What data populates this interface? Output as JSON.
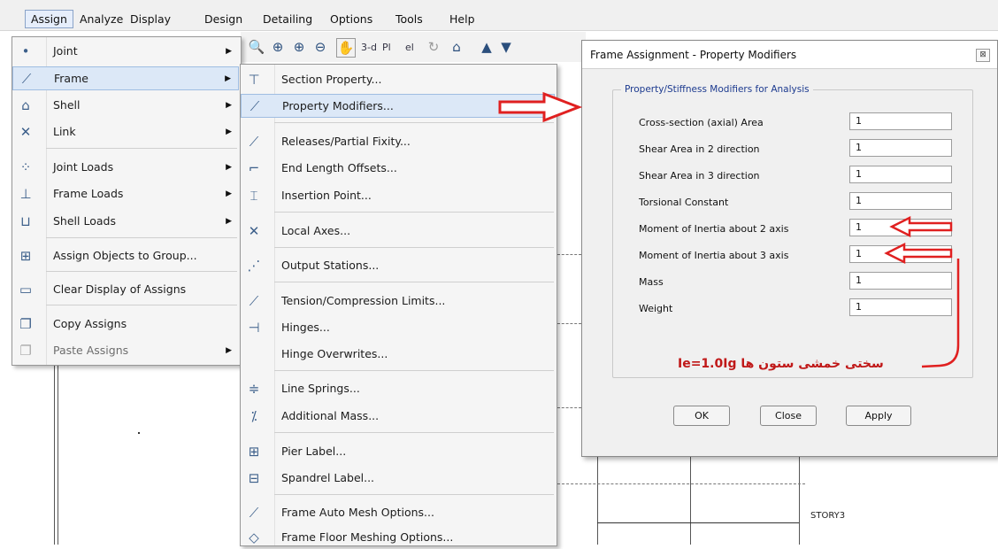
{
  "menubar": [
    "Assign",
    "Analyze",
    "Display",
    "Design",
    "Detailing",
    "Options",
    "Tools",
    "Help"
  ],
  "toolbar": {
    "view_3d": "3-d",
    "view_plan": "Pl",
    "view_elev": "el"
  },
  "assign_menu": {
    "items": [
      {
        "label": "Joint",
        "icon": "joint-icon",
        "submenu": true
      },
      {
        "label": "Frame",
        "icon": "frame-icon",
        "submenu": true,
        "highlighted": true
      },
      {
        "label": "Shell",
        "icon": "shell-icon",
        "submenu": true
      },
      {
        "label": "Link",
        "icon": "link-icon",
        "submenu": true
      },
      {
        "label": "Joint Loads",
        "icon": "joint-loads-icon",
        "submenu": true
      },
      {
        "label": "Frame Loads",
        "icon": "frame-loads-icon",
        "submenu": true
      },
      {
        "label": "Shell Loads",
        "icon": "shell-loads-icon",
        "submenu": true
      },
      {
        "label": "Assign Objects to Group...",
        "icon": "group-icon"
      },
      {
        "label": "Clear Display of Assigns",
        "icon": "clear-display-icon"
      },
      {
        "label": "Copy Assigns",
        "icon": "copy-icon"
      },
      {
        "label": "Paste Assigns",
        "icon": "paste-icon",
        "submenu": true,
        "disabled": true
      }
    ]
  },
  "frame_submenu": {
    "items": [
      {
        "label": "Section Property...",
        "icon": "section-property-icon"
      },
      {
        "label": "Property Modifiers...",
        "icon": "property-modifiers-icon",
        "highlighted": true
      },
      {
        "label": "Releases/Partial Fixity...",
        "icon": "releases-icon"
      },
      {
        "label": "End Length Offsets...",
        "icon": "end-offsets-icon"
      },
      {
        "label": "Insertion Point...",
        "icon": "insertion-point-icon"
      },
      {
        "label": "Local Axes...",
        "icon": "local-axes-icon"
      },
      {
        "label": "Output Stations...",
        "icon": "output-stations-icon"
      },
      {
        "label": "Tension/Compression Limits...",
        "icon": "tension-limits-icon"
      },
      {
        "label": "Hinges...",
        "icon": "hinges-icon"
      },
      {
        "label": "Hinge Overwrites...",
        "icon": ""
      },
      {
        "label": "Line Springs...",
        "icon": "line-springs-icon"
      },
      {
        "label": "Additional Mass...",
        "icon": "additional-mass-icon"
      },
      {
        "label": "Pier Label...",
        "icon": "pier-label-icon"
      },
      {
        "label": "Spandrel Label...",
        "icon": "spandrel-label-icon"
      },
      {
        "label": "Frame Auto Mesh Options...",
        "icon": "auto-mesh-icon"
      },
      {
        "label": "Frame Floor Meshing Options...",
        "icon": "floor-meshing-icon"
      }
    ]
  },
  "dialog": {
    "title": "Frame Assignment - Property Modifiers",
    "close_glyph": "⊠",
    "group_title": "Property/Stiffness Modifiers for Analysis",
    "fields": [
      {
        "label": "Cross-section (axial) Area",
        "value": "1"
      },
      {
        "label": "Shear Area in 2 direction",
        "value": "1"
      },
      {
        "label": "Shear Area in 3 direction",
        "value": "1"
      },
      {
        "label": "Torsional Constant",
        "value": "1"
      },
      {
        "label": "Moment of Inertia about 2 axis",
        "value": "1"
      },
      {
        "label": "Moment of Inertia about 3 axis",
        "value": "1"
      },
      {
        "label": "Mass",
        "value": "1"
      },
      {
        "label": "Weight",
        "value": "1"
      }
    ],
    "buttons": {
      "ok": "OK",
      "close": "Close",
      "apply": "Apply"
    }
  },
  "annotation": {
    "text": "سختی خمشی ستون ها Ie=1.0Ig",
    "color": "#c01818"
  },
  "canvas": {
    "story_labels": [
      "STORY3"
    ]
  },
  "colors": {
    "arrow": "#e02020",
    "highlight": "#dce8f7",
    "group_title": "#1c3a8f"
  }
}
